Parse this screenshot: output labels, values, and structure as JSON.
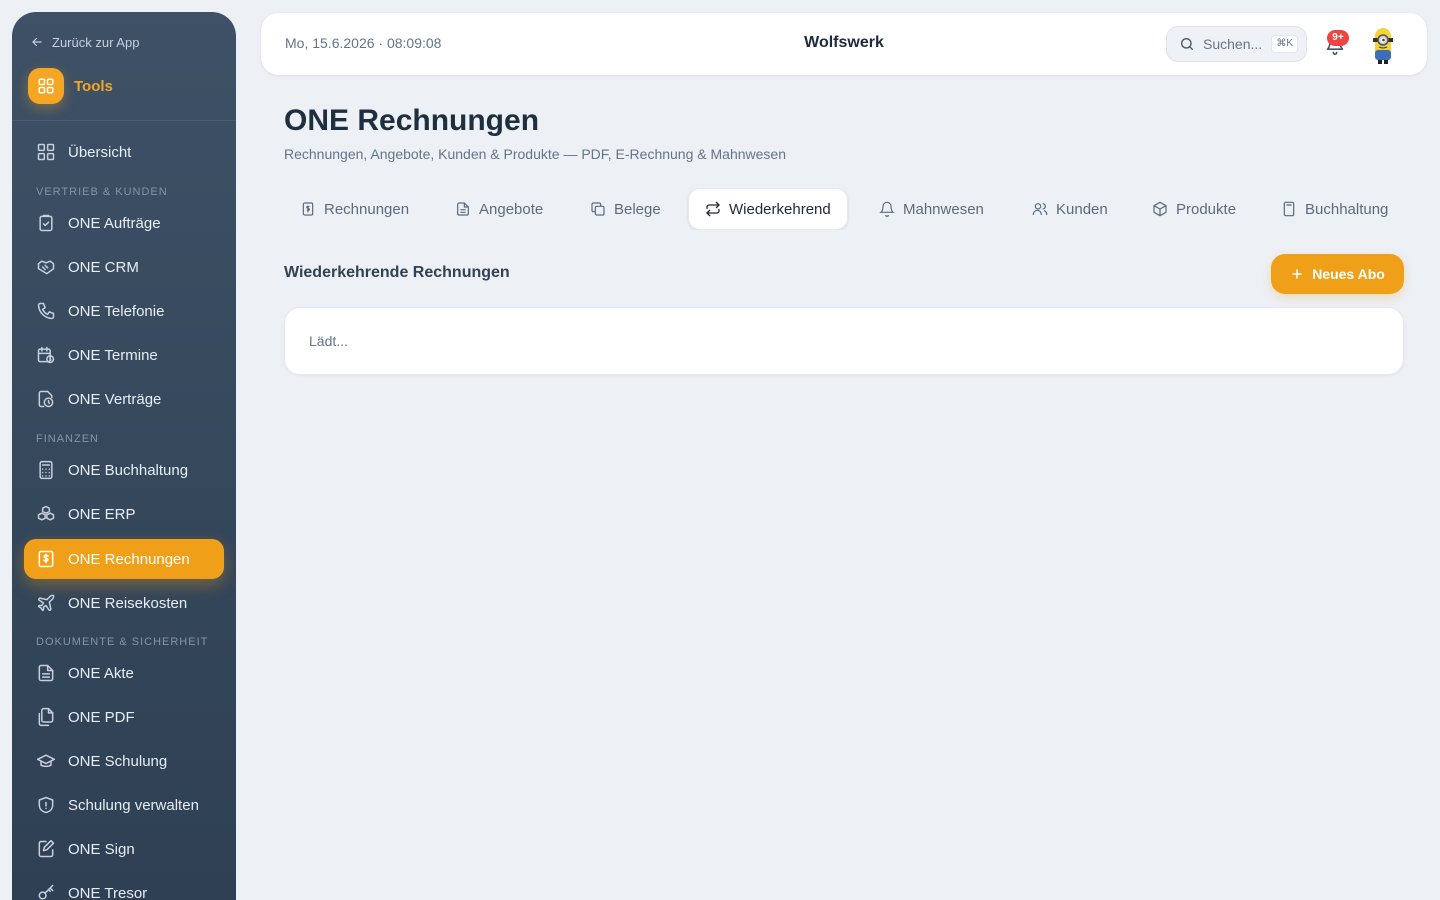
{
  "sidebar": {
    "back_label": "Zurück zur App",
    "tools_label": "Tools",
    "overview": "Übersicht",
    "sections": {
      "sales": "VERTRIEB & KUNDEN",
      "finance": "FINANZEN",
      "docs": "DOKUMENTE & SICHERHEIT"
    },
    "items": {
      "auftraege": "ONE Aufträge",
      "crm": "ONE CRM",
      "telefonie": "ONE Telefonie",
      "termine": "ONE Termine",
      "vertraege": "ONE Verträge",
      "buchhaltung": "ONE Buchhaltung",
      "erp": "ONE ERP",
      "rechnungen": "ONE Rechnungen",
      "reisekosten": "ONE Reisekosten",
      "akte": "ONE Akte",
      "pdf": "ONE PDF",
      "schulung": "ONE Schulung",
      "schulung_verwalten": "Schulung verwalten",
      "sign": "ONE Sign",
      "tresor": "ONE Tresor"
    },
    "active_item": "ONE Rechnungen",
    "accent_color": "#f0a018"
  },
  "topbar": {
    "datetime": "Mo, 15.6.2026 · 08:09:08",
    "brand": "Wolfswerk",
    "search_placeholder": "Suchen...",
    "search_shortcut": "⌘K",
    "notification_count": "9+"
  },
  "main": {
    "title": "ONE Rechnungen",
    "subtitle": "Rechnungen, Angebote, Kunden & Produkte — PDF, E-Rechnung & Mahnwesen",
    "tabs": {
      "rechnungen": "Rechnungen",
      "angebote": "Angebote",
      "belege": "Belege",
      "wiederkehrend": "Wiederkehrend",
      "mahnwesen": "Mahnwesen",
      "kunden": "Kunden",
      "produkte": "Produkte",
      "buchhaltung": "Buchhaltung"
    },
    "active_tab": "Wiederkehrend",
    "section_title": "Wiederkehrende Rechnungen",
    "new_button": "Neues Abo",
    "loading_text": "Lädt..."
  }
}
